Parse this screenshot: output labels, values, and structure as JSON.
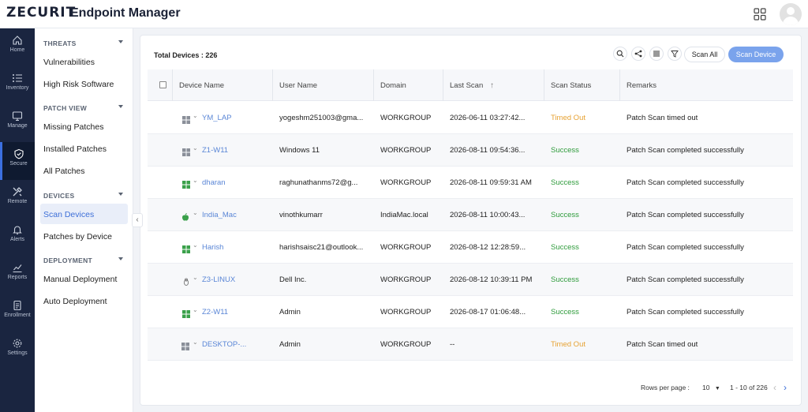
{
  "header": {
    "logo": "ZECURIT",
    "title": "Endpoint Manager"
  },
  "rail": [
    {
      "label": "Home",
      "icon": "home-icon"
    },
    {
      "label": "Inventory",
      "icon": "inventory-icon"
    },
    {
      "label": "Manage",
      "icon": "monitor-icon"
    },
    {
      "label": "Secure",
      "icon": "shield-icon",
      "active": true
    },
    {
      "label": "Remote",
      "icon": "tools-icon"
    },
    {
      "label": "Alerts",
      "icon": "bell-icon"
    },
    {
      "label": "Reports",
      "icon": "chart-icon"
    },
    {
      "label": "Enrollment",
      "icon": "enrollment-icon"
    },
    {
      "label": "Settings",
      "icon": "gear-icon"
    }
  ],
  "sidebar": {
    "threats_h": "THREATS",
    "vulnerabilities": "Vulnerabilities",
    "high_risk": "High Risk Software",
    "patch_view_h": "PATCH VIEW",
    "missing": "Missing Patches",
    "installed": "Installed Patches",
    "all": "All Patches",
    "devices_h": "DEVICES",
    "scan_devices": "Scan Devices",
    "patches_by_device": "Patches by Device",
    "deployment_h": "DEPLOYMENT",
    "manual": "Manual Deployment",
    "auto": "Auto Deployment"
  },
  "toolbar": {
    "total": "Total Devices : 226",
    "scan_all": "Scan All",
    "scan_device": "Scan Device"
  },
  "table": {
    "headers": [
      "Device Name",
      "User Name",
      "Domain",
      "Last Scan",
      "Scan Status",
      "Remarks"
    ],
    "sort_indicator": "↑",
    "rows": [
      {
        "os": "windows",
        "device": "YM_LAP",
        "user": "yogeshm251003@gma...",
        "domain": "WORKGROUP",
        "last_scan": "2026-06-11 03:27:42...",
        "status": "Timed Out",
        "remarks": "Patch Scan timed out"
      },
      {
        "os": "windows",
        "device": "Z1-W11",
        "user": "Windows 11",
        "domain": "WORKGROUP",
        "last_scan": "2026-08-11 09:54:36...",
        "status": "Success",
        "remarks": "Patch Scan completed successfully"
      },
      {
        "os": "windows-green",
        "device": "dharan",
        "user": "raghunathanms72@g...",
        "domain": "WORKGROUP",
        "last_scan": "2026-08-11 09:59:31 AM",
        "status": "Success",
        "remarks": "Patch Scan completed successfully"
      },
      {
        "os": "apple",
        "device": "India_Mac",
        "user": "vinothkumarr",
        "domain": "IndiaMac.local",
        "last_scan": "2026-08-11 10:00:43...",
        "status": "Success",
        "remarks": "Patch Scan completed successfully"
      },
      {
        "os": "windows-green",
        "device": "Harish",
        "user": "harishsaisc21@outlook...",
        "domain": "WORKGROUP",
        "last_scan": "2026-08-12 12:28:59...",
        "status": "Success",
        "remarks": "Patch Scan completed successfully"
      },
      {
        "os": "linux",
        "device": "Z3-LINUX",
        "user": "Dell Inc.",
        "domain": "WORKGROUP",
        "last_scan": "2026-08-12 10:39:11 PM",
        "status": "Success",
        "remarks": "Patch Scan completed successfully"
      },
      {
        "os": "windows-green",
        "device": "Z2-W11",
        "user": "Admin",
        "domain": "WORKGROUP",
        "last_scan": "2026-08-17 01:06:48...",
        "status": "Success",
        "remarks": "Patch Scan completed successfully"
      },
      {
        "os": "windows",
        "device": "DESKTOP-...",
        "user": "Admin",
        "domain": "WORKGROUP",
        "last_scan": "--",
        "status": "Timed Out",
        "remarks": "Patch Scan timed out"
      }
    ]
  },
  "pagination": {
    "rows_label": "Rows per page :",
    "rows_value": "10",
    "range": "1 - 10 of 226"
  },
  "colors": {
    "accent": "#3d6fd8",
    "success": "#2e9b3b",
    "timed_out": "#e7a233",
    "rail_bg": "#1a2540"
  }
}
